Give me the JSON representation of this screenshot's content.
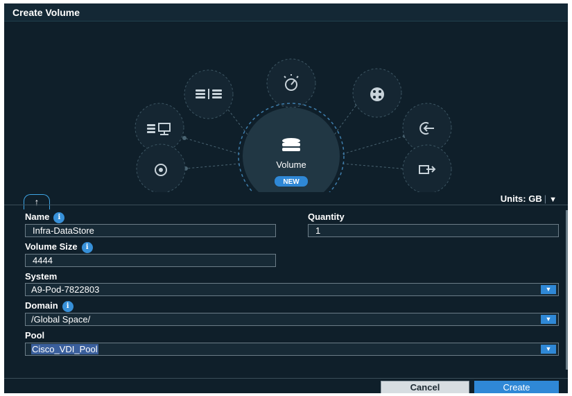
{
  "dialog": {
    "title": "Create Volume"
  },
  "hub": {
    "center_label": "Volume",
    "badge": "NEW"
  },
  "tab": {
    "icon": "arrow-up-icon",
    "glyph": "↑"
  },
  "units": {
    "label": "Units: GB",
    "separator": "|",
    "chevron": "▼"
  },
  "form": {
    "name": {
      "label": "Name",
      "value": "Infra-DataStore",
      "info": "i"
    },
    "quantity": {
      "label": "Quantity",
      "value": "1"
    },
    "volume_size": {
      "label": "Volume Size",
      "value": "4444",
      "info": "i"
    },
    "system": {
      "label": "System",
      "value": "A9-Pod-7822803"
    },
    "domain": {
      "label": "Domain",
      "value": "/Global Space/",
      "info": "i"
    },
    "pool": {
      "label": "Pool",
      "value": "Cisco_VDI_Pool"
    },
    "dropdown_glyph": "▼"
  },
  "buttons": {
    "cancel": "Cancel",
    "create": "Create"
  },
  "colors": {
    "background": "#0f1f2a",
    "accent": "#2f88d6",
    "border": "#6c7d88",
    "dashed_ring": "#3d5663"
  },
  "satellite_icons": [
    "storage-icon",
    "host-icon",
    "disk-icon",
    "performance-icon",
    "network-icon",
    "import-icon",
    "export-icon"
  ]
}
